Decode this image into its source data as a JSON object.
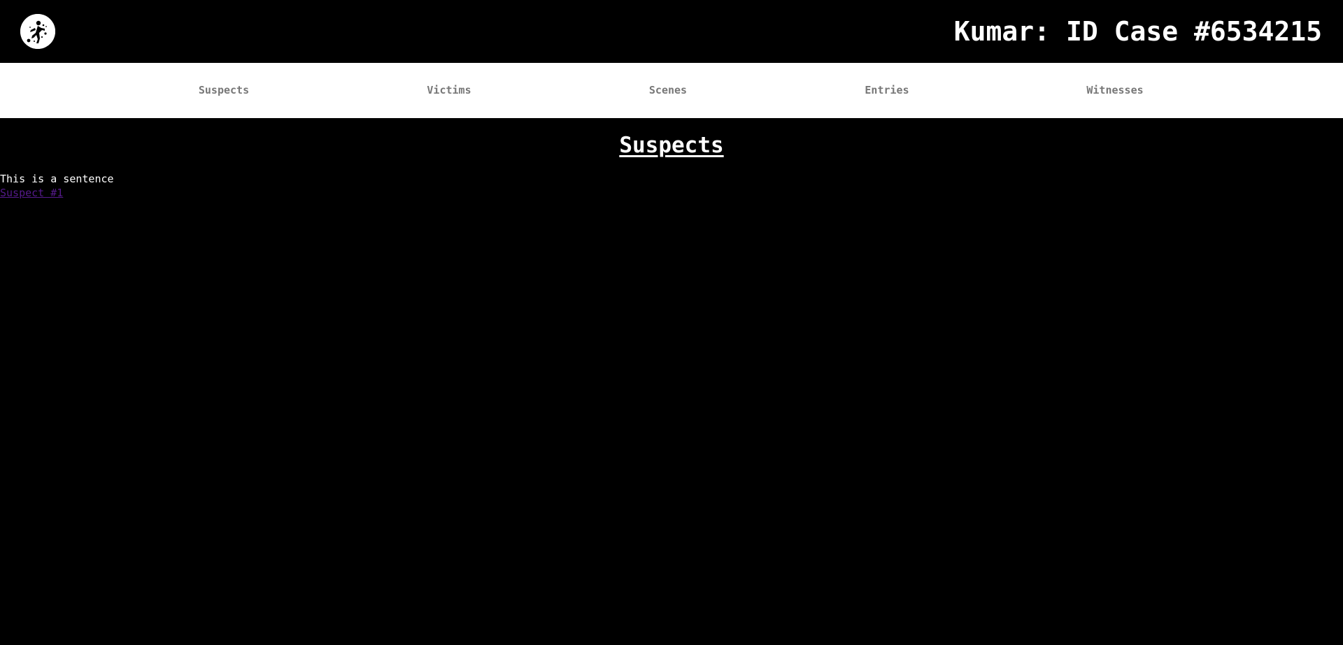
{
  "header": {
    "logo_icon": "crime-scene-figure-icon",
    "title": "Kumar: ID Case #6534215"
  },
  "nav": {
    "items": [
      {
        "label": "Suspects"
      },
      {
        "label": "Victims"
      },
      {
        "label": "Scenes"
      },
      {
        "label": "Entries"
      },
      {
        "label": "Witnesses"
      }
    ]
  },
  "main": {
    "heading": "Suspects",
    "sentence": "This is a sentence",
    "links": [
      {
        "label": "Suspect #1"
      }
    ]
  },
  "colors": {
    "background": "#000000",
    "nav_background": "#ffffff",
    "nav_text": "#777777",
    "text": "#ffffff",
    "visited_link": "#551a8b"
  }
}
